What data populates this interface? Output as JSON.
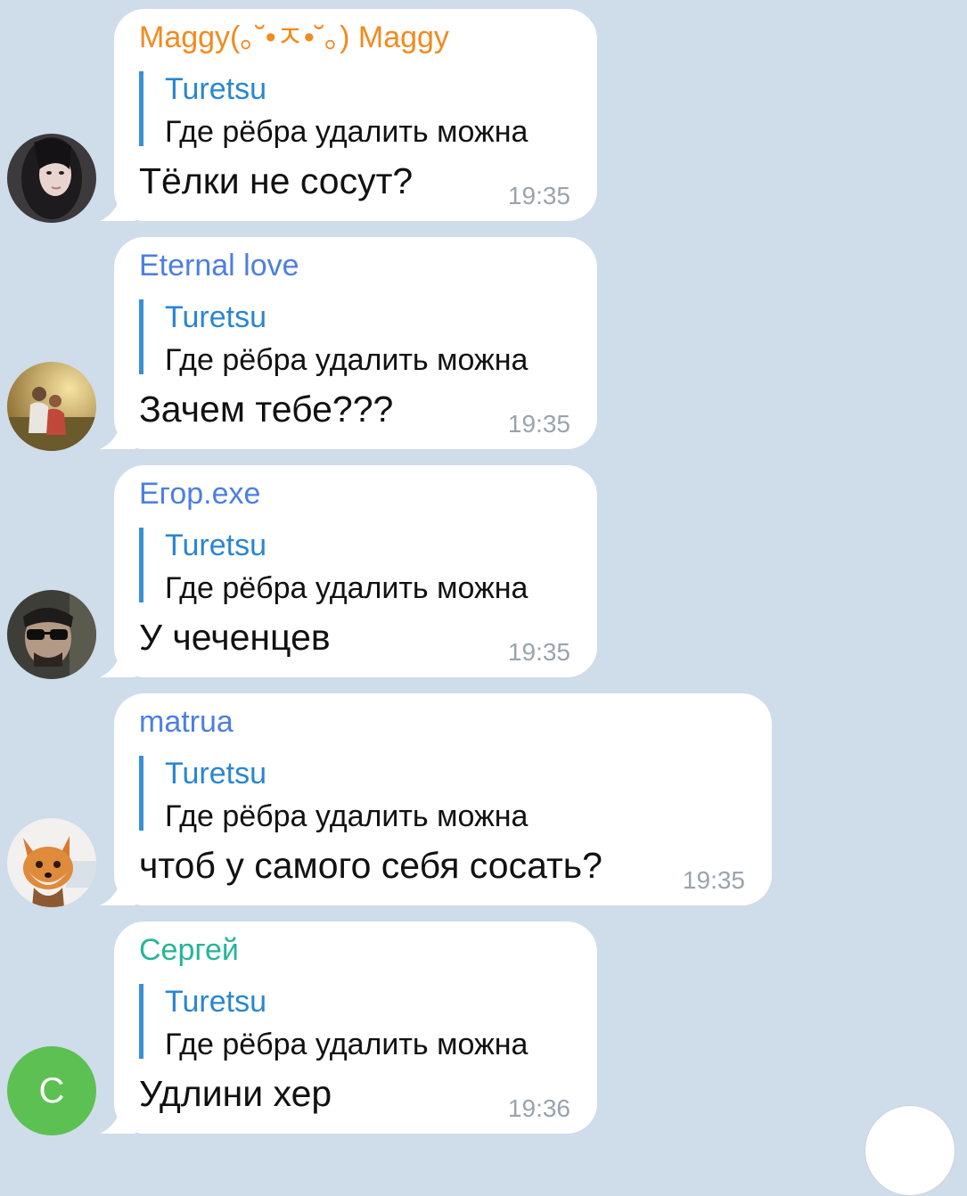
{
  "messages": [
    {
      "sender": "Maggy(｡˘•ㅈ•˘｡) Maggy",
      "sender_color": "#f28a1e",
      "reply_name": "Turetsu",
      "reply_text": "Где рёбра удалить можна",
      "text": "Тёлки не сосут?",
      "time": "19:35",
      "avatar": "woman-dark-hair-photo"
    },
    {
      "sender": "Eternal love",
      "sender_color": "#4c7fe0",
      "reply_name": "Turetsu",
      "reply_text": "Где рёбра удалить можна",
      "text": "Зачем тебе???",
      "time": "19:35",
      "avatar": "couple-sunset-photo"
    },
    {
      "sender": "Егор.exe",
      "sender_color": "#4c7fe0",
      "reply_name": "Turetsu",
      "reply_text": "Где рёбра удалить можна",
      "text": "У чеченцев",
      "time": "19:35",
      "avatar": "man-sunglasses-photo"
    },
    {
      "sender": "matrua",
      "sender_color": "#4c7fe0",
      "reply_name": "Turetsu",
      "reply_text": "Где рёбра удалить можна",
      "text": "чтоб у самого себя сосать?",
      "time": "19:35",
      "avatar": "fox-photo"
    },
    {
      "sender": "Сергей",
      "sender_color": "#27b49a",
      "reply_name": "Turetsu",
      "reply_text": "Где рёбра удалить можна",
      "text": "Удлини хер",
      "time": "19:36",
      "avatar_letter": "С",
      "avatar_color": "#5cc152"
    }
  ]
}
